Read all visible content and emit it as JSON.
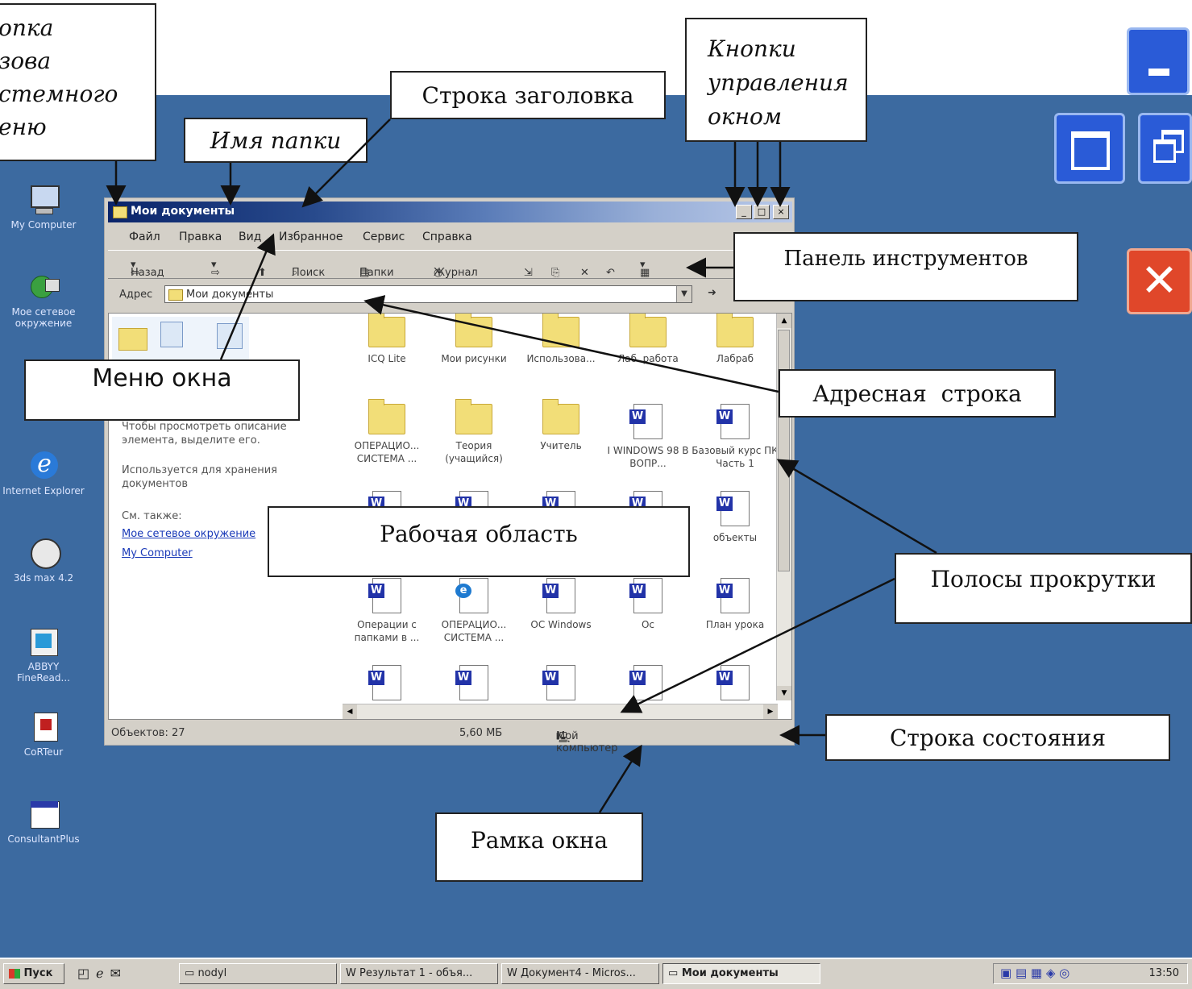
{
  "window": {
    "title": "Мои документы",
    "menu": [
      "Файл",
      "Правка",
      "Вид",
      "Избранное",
      "Сервис",
      "Справка"
    ],
    "toolbar": {
      "back": "Назад",
      "search": "Поиск",
      "folders": "Папки",
      "history": "Журнал"
    },
    "address": {
      "label": "Адрес",
      "value": "Мои документы"
    },
    "sidebar": {
      "hint": "Чтобы просмотреть описание элемента, выделите его.",
      "usage": "Используется для хранения документов",
      "see_also": "См. также:",
      "links": [
        "Мое сетевое окружение",
        "My Computer"
      ]
    },
    "files": [
      {
        "name": "ICQ Lite",
        "type": "folder"
      },
      {
        "name": "Мои рисунки",
        "type": "folder"
      },
      {
        "name": "Использова...",
        "type": "folder"
      },
      {
        "name": "Лаб. работа",
        "type": "folder"
      },
      {
        "name": "Лабраб",
        "type": "folder"
      },
      {
        "name": "ОПЕРАЦИО... СИСТЕМА ...",
        "type": "folder"
      },
      {
        "name": "Теория (учащийся)",
        "type": "folder"
      },
      {
        "name": "Учитель",
        "type": "folder"
      },
      {
        "name": "I WINDOWS 98 В ВОПР...",
        "type": "doc"
      },
      {
        "name": "Базовый курс ПК Часть 1",
        "type": "doc"
      },
      {
        "name": "",
        "type": "doc"
      },
      {
        "name": "",
        "type": "doc"
      },
      {
        "name": "",
        "type": "doc"
      },
      {
        "name": "",
        "type": "doc"
      },
      {
        "name": "объекты",
        "type": "doc"
      },
      {
        "name": "Операции с папками в ...",
        "type": "doc"
      },
      {
        "name": "ОПЕРАЦИО... СИСТЕМА ...",
        "type": "ie"
      },
      {
        "name": "ОС Windows",
        "type": "doc"
      },
      {
        "name": "Ос",
        "type": "doc"
      },
      {
        "name": "План урока",
        "type": "doc"
      },
      {
        "name": "",
        "type": "doc"
      },
      {
        "name": "",
        "type": "doc"
      },
      {
        "name": "",
        "type": "doc"
      },
      {
        "name": "",
        "type": "doc"
      },
      {
        "name": "",
        "type": "doc"
      }
    ],
    "status": {
      "objects": "Объектов: 27",
      "size": "5,60 МБ",
      "location": "Мой компьютер"
    }
  },
  "desktop_icons": [
    {
      "label": "My Computer",
      "icon": "computer-icon"
    },
    {
      "label": "Мое сетевое окружение",
      "icon": "network-icon"
    },
    {
      "label": "Internet Explorer",
      "icon": "ie-icon"
    },
    {
      "label": "3ds max 4.2",
      "icon": "3dsmax-icon"
    },
    {
      "label": "ABBYY FineRead...",
      "icon": "abbyy-icon"
    },
    {
      "label": "CoRTeur",
      "icon": "app-icon"
    },
    {
      "label": "ConsultantPlus",
      "icon": "consultant-icon"
    }
  ],
  "callouts": {
    "start_menu": "Кнопка вызова системного меню",
    "start_menu_visible": [
      "опка",
      "зова",
      "стемного",
      "еню"
    ],
    "folder_name": "Имя папки",
    "title_bar": "Строка заголовка",
    "window_buttons": [
      "Кнопки",
      "управления",
      "окном"
    ],
    "toolbar": "Панель инструментов",
    "window_menu": "Меню окна",
    "address_bar": "Адресная  строка",
    "workspace": "Рабочая область",
    "scrollbars": "Полосы прокрутки",
    "status_bar": "Строка состояния",
    "window_frame": "Рамка окна"
  },
  "taskbar": {
    "start": "Пуск",
    "items": [
      "nodyl",
      "Результат 1 - объя...",
      "Документ4 - Micros...",
      "Мои документы"
    ],
    "time": "13:50"
  },
  "colors": {
    "desktop": "#3c6aa0",
    "titlebar_active": "#0a246a",
    "close_button": "#e0472a",
    "caption_button": "#2a5bd7"
  }
}
